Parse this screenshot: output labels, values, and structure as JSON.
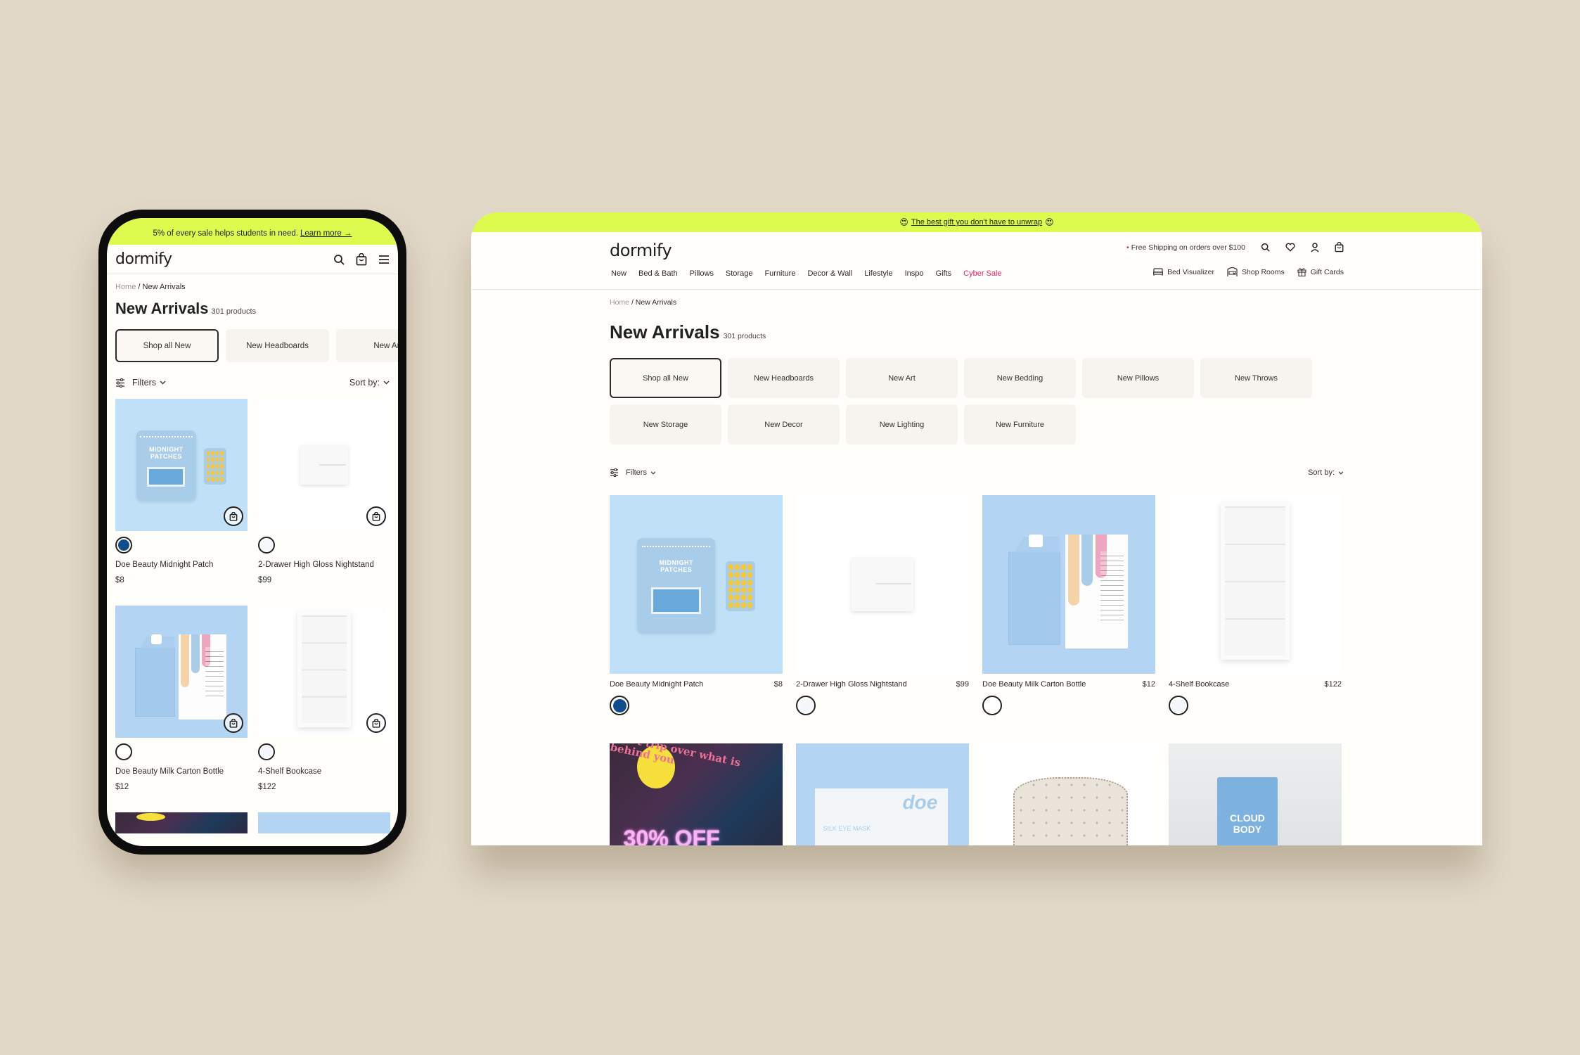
{
  "mobile": {
    "banner": {
      "text": "5% of every sale helps students in need.",
      "link": "Learn more →"
    },
    "logo": "dormify",
    "icons": [
      "search-icon",
      "bag-icon",
      "menu-icon"
    ],
    "breadcrumb": {
      "home": "Home",
      "separator": "/",
      "current": "New Arrivals"
    },
    "title": "New Arrivals",
    "count": "301 products",
    "pills": [
      "Shop all New",
      "New Headboards",
      "New Art"
    ],
    "filters_label": "Filters",
    "sort_label": "Sort by:",
    "products": [
      {
        "name": "Doe Beauty Midnight Patch",
        "price": "$8",
        "swatch": "#0f4d8f",
        "swatch_selected": true
      },
      {
        "name": "2-Drawer High Gloss Nightstand",
        "price": "$99",
        "swatch": "#f4f7fb",
        "swatch_selected": false
      },
      {
        "name": "Doe Beauty Milk Carton Bottle",
        "price": "$12",
        "swatch": "#ffffff",
        "swatch_selected": false
      },
      {
        "name": "4-Shelf Bookcase",
        "price": "$122",
        "swatch": "#f4f7fb",
        "swatch_selected": false
      }
    ]
  },
  "desktop": {
    "banner": {
      "emoji": "😍",
      "text": "The best gift you don't have to unwrap"
    },
    "logo": "dormify",
    "nav": [
      "New",
      "Bed & Bath",
      "Pillows",
      "Storage",
      "Furniture",
      "Decor & Wall",
      "Lifestyle",
      "Inspo",
      "Gifts",
      "Cyber Sale"
    ],
    "shipping_note": "Free Shipping on orders over $100",
    "utility_links": [
      "Bed Visualizer",
      "Shop Rooms",
      "Gift Cards"
    ],
    "breadcrumb": {
      "home": "Home",
      "separator": "/",
      "current": "New Arrivals"
    },
    "title": "New Arrivals",
    "count": "301 products",
    "pills": [
      "Shop all New",
      "New Headboards",
      "New Art",
      "New Bedding",
      "New Pillows",
      "New Throws",
      "New Storage",
      "New Decor",
      "New Lighting",
      "New Furniture"
    ],
    "active_pill": "Shop all New",
    "filters_label": "Filters",
    "sort_label": "Sort by:",
    "products": [
      {
        "name": "Doe Beauty Midnight Patch",
        "price": "$8",
        "swatch": "#0f4d8f",
        "swatch_selected": true
      },
      {
        "name": "2-Drawer High Gloss Nightstand",
        "price": "$99",
        "swatch": "#f4f7fb",
        "swatch_selected": false
      },
      {
        "name": "Doe Beauty Milk Carton Bottle",
        "price": "$12",
        "swatch": "#ffffff",
        "swatch_selected": false
      },
      {
        "name": "4-Shelf Bookcase",
        "price": "$122",
        "swatch": "#f4f7fb",
        "swatch_selected": false
      }
    ],
    "promo_tiles": [
      {
        "caption": "30% OFF",
        "quote": "don't trip over what is behind you"
      },
      {
        "brand": "doe",
        "caption": "SILK EYE MASK"
      },
      {
        "caption": ""
      },
      {
        "caption": "CLOUD BODY"
      }
    ]
  },
  "colors": {
    "accent_lime": "#dcfb4e",
    "sale_pink": "#e0245e",
    "background": "#e3d9c8"
  }
}
